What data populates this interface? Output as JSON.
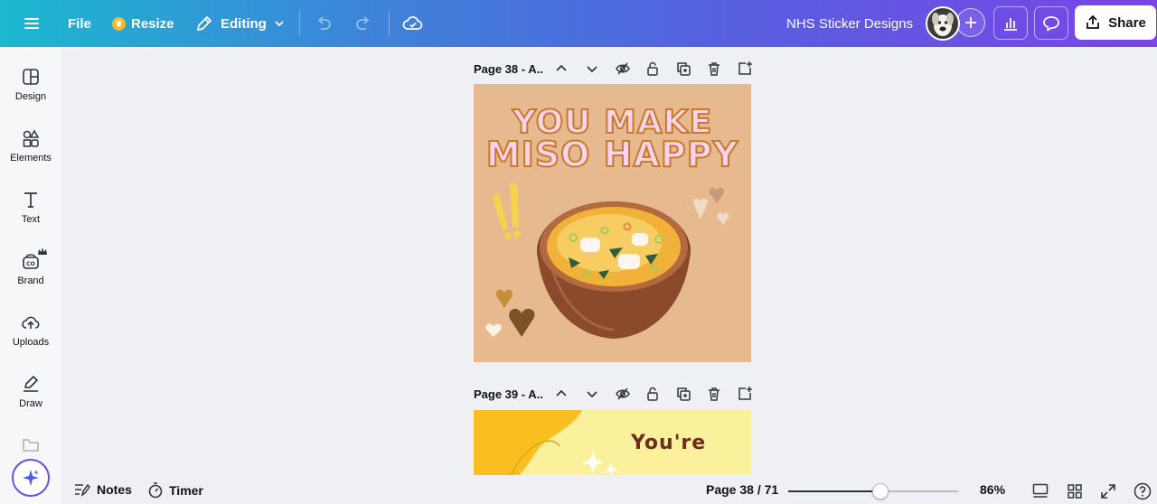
{
  "topbar": {
    "file_label": "File",
    "resize_label": "Resize",
    "editing_label": "Editing",
    "doc_title": "NHS Sticker Designs",
    "share_label": "Share",
    "gradient_start": "#1bb8cf",
    "gradient_end": "#7a44e6"
  },
  "sidebar": {
    "items": [
      {
        "label": "Design",
        "icon": "layout-icon"
      },
      {
        "label": "Elements",
        "icon": "shapes-icon"
      },
      {
        "label": "Text",
        "icon": "text-icon"
      },
      {
        "label": "Brand",
        "icon": "brand-icon"
      },
      {
        "label": "Uploads",
        "icon": "upload-cloud-icon"
      },
      {
        "label": "Draw",
        "icon": "pen-icon"
      }
    ]
  },
  "pages": [
    {
      "header": "Page 38 - A..",
      "headline_line1": "YOU MAKE",
      "headline_line2": "MISO HAPPY",
      "background": "#e6b98e"
    },
    {
      "header": "Page 39 - A..",
      "text": "You're",
      "background": "#fbf09c"
    }
  ],
  "bottombar": {
    "notes_label": "Notes",
    "timer_label": "Timer",
    "page_indicator": "Page 38 / 71",
    "zoom_label": "86%",
    "zoom_fraction": 0.54
  }
}
